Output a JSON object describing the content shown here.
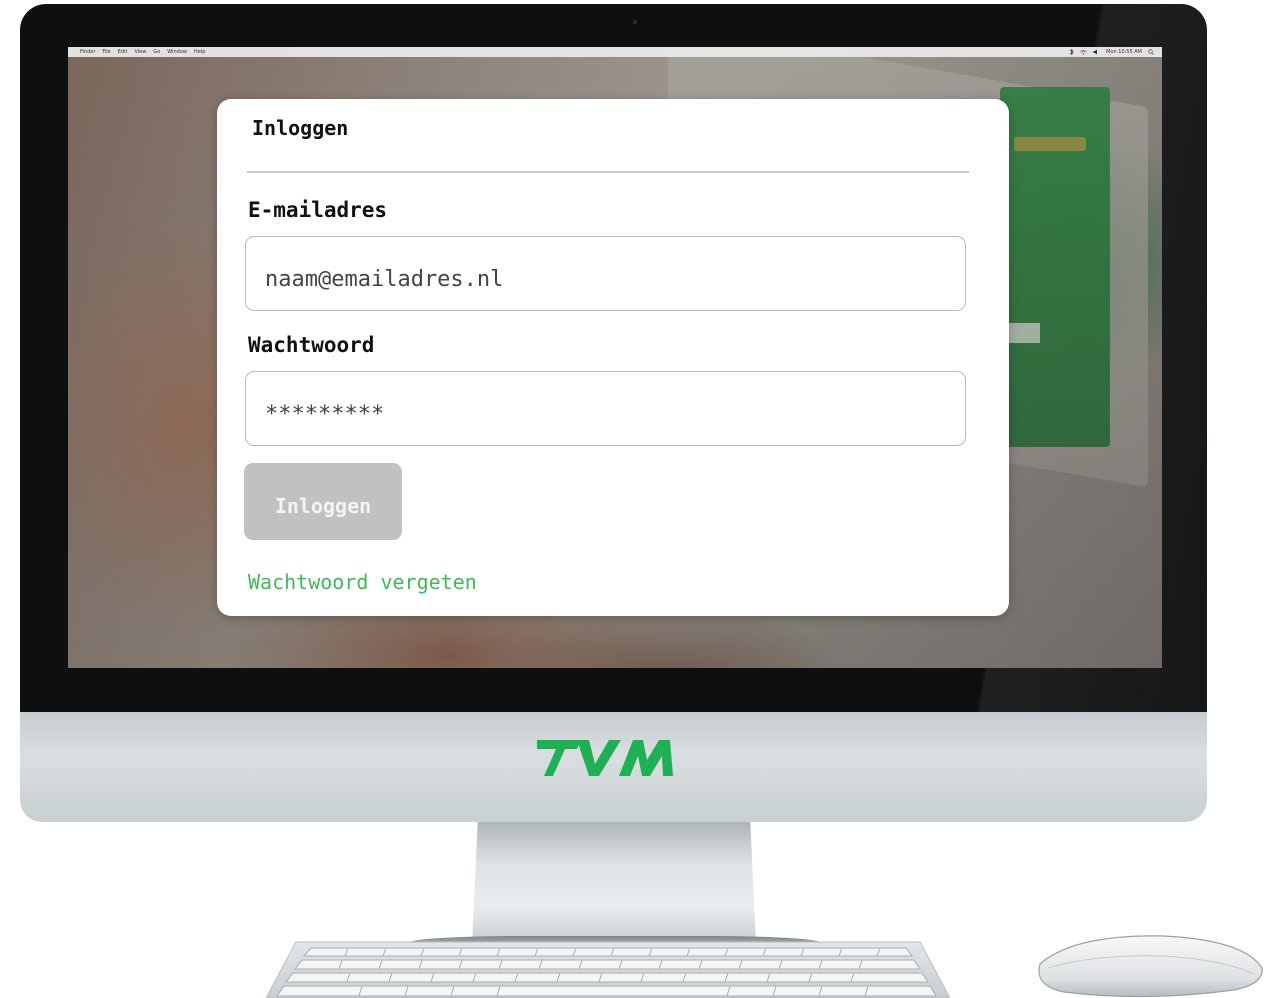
{
  "menubar": {
    "apple_glyph": "",
    "items": [
      "Finder",
      "File",
      "Edit",
      "View",
      "Go",
      "Window",
      "Help"
    ],
    "clock": "Mon 10:55 AM"
  },
  "login": {
    "title": "Inloggen",
    "email_label": "E-mailadres",
    "email_value": "naam@emailadres.nl",
    "password_label": "Wachtwoord",
    "password_value": "*********",
    "submit_label": "Inloggen",
    "submit_state": "disabled",
    "forgot_link": "Wachtwoord vergeten"
  },
  "brand": {
    "logo_text": "TVM",
    "logo_color": "#1fb055"
  },
  "colors": {
    "link_green": "#3fb95a",
    "button_disabled": "#c1c1c1"
  },
  "icons": [
    "apple-icon",
    "wifi-icon",
    "volume-icon",
    "bluetooth-icon",
    "search-icon"
  ]
}
